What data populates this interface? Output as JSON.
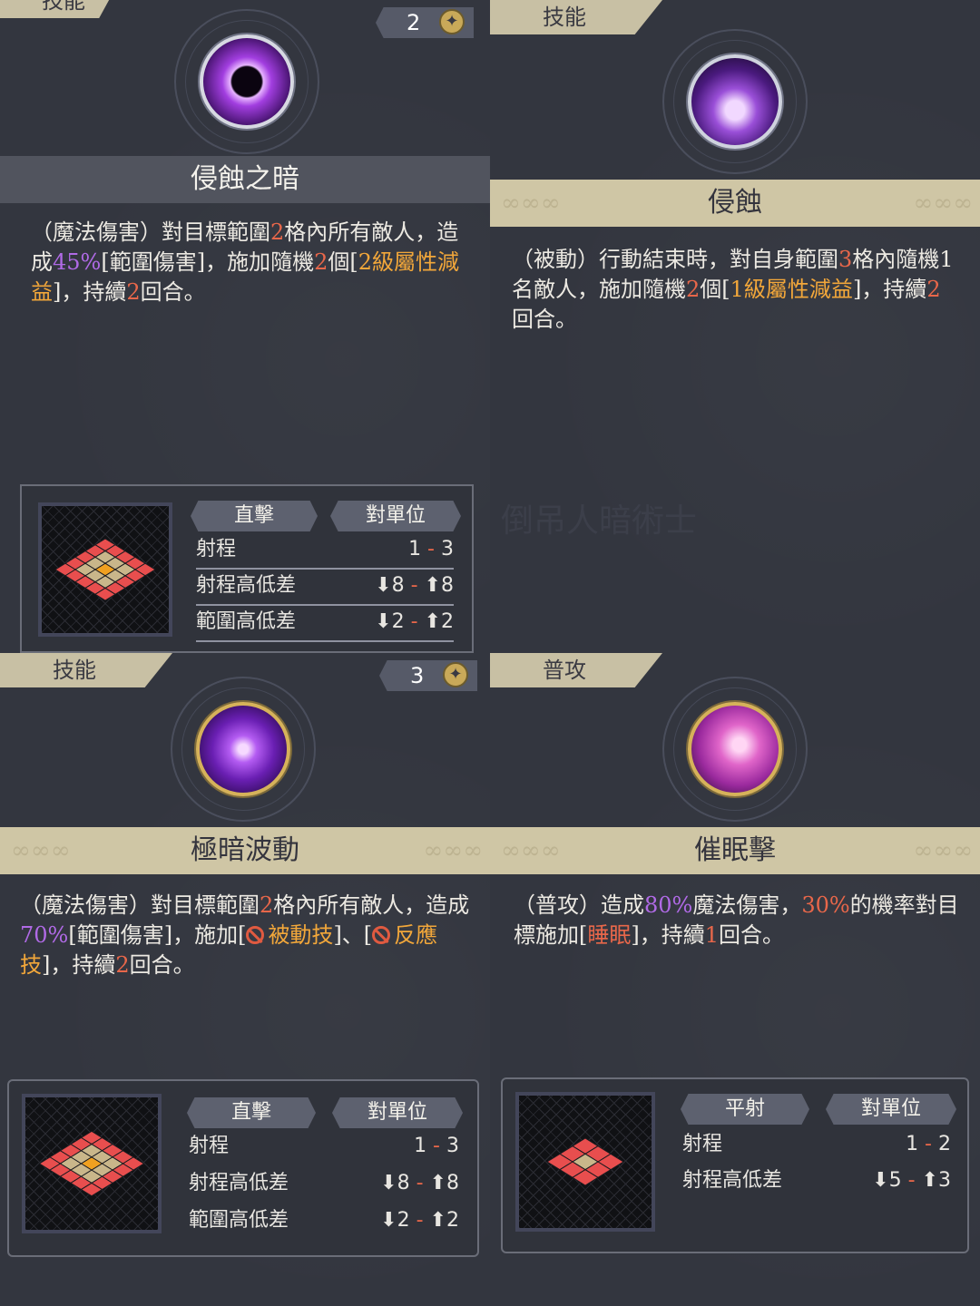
{
  "cards": [
    {
      "tag": "技能",
      "cost": "2",
      "title": "侵蝕之暗",
      "desc": [
        {
          "t": "（魔法傷害）對目標範圍"
        },
        {
          "t": "2",
          "c": "r"
        },
        {
          "t": "格內所有敵人，造成"
        },
        {
          "t": "45%",
          "c": "p"
        },
        {
          "t": "[範圍傷害]，施加隨機"
        },
        {
          "t": "2",
          "c": "r"
        },
        {
          "t": "個["
        },
        {
          "t": "2級屬性減益",
          "c": "y"
        },
        {
          "t": "]，持續"
        },
        {
          "t": "2",
          "c": "r"
        },
        {
          "t": "回合。"
        }
      ],
      "chip_a": "直擊",
      "chip_b": "對單位",
      "rows": [
        {
          "k": "射程",
          "lo": "1",
          "hi": "3"
        },
        {
          "k": "射程高低差",
          "lo": "⬇8",
          "hi": "⬆8"
        },
        {
          "k": "範圍高低差",
          "lo": "⬇2",
          "hi": "⬆2"
        }
      ]
    },
    {
      "tag": "技能",
      "title": "侵蝕",
      "desc": [
        {
          "t": "（被動）行動結束時，對自身範圍"
        },
        {
          "t": "3",
          "c": "r"
        },
        {
          "t": "格內隨機1名敵人，施加隨機"
        },
        {
          "t": "2",
          "c": "r"
        },
        {
          "t": "個["
        },
        {
          "t": "1級屬性減益",
          "c": "y"
        },
        {
          "t": "]，持續"
        },
        {
          "t": "2",
          "c": "r"
        },
        {
          "t": "回合。"
        }
      ],
      "watermark": "倒吊人暗術士"
    },
    {
      "tag": "技能",
      "cost": "3",
      "title": "極暗波動",
      "desc": [
        {
          "t": "（魔法傷害）對目標範圍"
        },
        {
          "t": "2",
          "c": "r"
        },
        {
          "t": "格內所有敵人，造成"
        },
        {
          "t": "70%",
          "c": "p"
        },
        {
          "t": "[範圍傷害]，施加["
        },
        {
          "ban": true
        },
        {
          "t": "被動技",
          "c": "y"
        },
        {
          "t": "]、["
        },
        {
          "ban": true
        },
        {
          "t": "反應技",
          "c": "y"
        },
        {
          "t": "]，持續"
        },
        {
          "t": "2",
          "c": "r"
        },
        {
          "t": "回合。"
        }
      ],
      "chip_a": "直擊",
      "chip_b": "對單位",
      "rows": [
        {
          "k": "射程",
          "lo": "1",
          "hi": "3"
        },
        {
          "k": "射程高低差",
          "lo": "⬇8",
          "hi": "⬆8"
        },
        {
          "k": "範圍高低差",
          "lo": "⬇2",
          "hi": "⬆2"
        }
      ]
    },
    {
      "tag": "普攻",
      "title": "催眠擊",
      "desc": [
        {
          "t": "（普攻）造成"
        },
        {
          "t": "80%",
          "c": "p"
        },
        {
          "t": "魔法傷害，"
        },
        {
          "t": "30%",
          "c": "r"
        },
        {
          "t": "的機率對目標施加["
        },
        {
          "t": "睡眠",
          "c": "r"
        },
        {
          "t": "]，持續"
        },
        {
          "t": "1",
          "c": "r"
        },
        {
          "t": "回合。"
        }
      ],
      "chip_a": "平射",
      "chip_b": "對單位",
      "rows": [
        {
          "k": "射程",
          "lo": "1",
          "hi": "2"
        },
        {
          "k": "射程高低差",
          "lo": "⬇5",
          "hi": "⬆3"
        }
      ]
    }
  ],
  "colors": {
    "accent_red": "#e8674a",
    "accent_purple": "#b06ae6",
    "accent_gold": "#f2a73a",
    "panel": "#33363f"
  }
}
